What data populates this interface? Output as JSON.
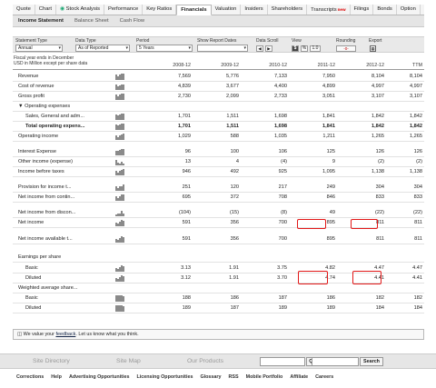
{
  "tabs": [
    "Quote",
    "Chart",
    "Stock Analysis",
    "Performance",
    "Key Ratios",
    "Financials",
    "Valuation",
    "Insiders",
    "Shareholders",
    "Transcripts",
    "Filings",
    "Bonds",
    "Option"
  ],
  "tabs_active": "Financials",
  "tabs_new_badge": "new",
  "subtabs": [
    "Income Statement",
    "Balance Sheet",
    "Cash Flow"
  ],
  "controls": {
    "statement_type": {
      "label": "Statement Type",
      "value": "Annual"
    },
    "data_type": {
      "label": "Data Type",
      "value": "As of Reported"
    },
    "period": {
      "label": "Period",
      "value": "5 Years"
    },
    "show_report_dates": {
      "label": "Show Report Dates",
      "value": ""
    },
    "data_scroll": {
      "label": "Data Scroll",
      "prev": "◀",
      "next": "▶"
    },
    "view": {
      "label": "View",
      "dollar": "$",
      "percent": "%",
      "zoom": "1.0"
    },
    "rounding": {
      "label": "Rounding",
      "value": "-0-"
    },
    "export": {
      "label": "Export"
    }
  },
  "fiscal_note_1": "Fiscal year ends in December",
  "fiscal_note_2": "USD in Million except per share data",
  "columns": [
    "2008-12",
    "2009-12",
    "2010-12",
    "2011-12",
    "2012-12",
    "TTM"
  ],
  "rows": [
    {
      "label": "Revenue",
      "values": [
        "7,569",
        "5,776",
        "7,133",
        "7,950",
        "8,104",
        "8,104"
      ],
      "spark": [
        7,
        5,
        7,
        8,
        8
      ]
    },
    {
      "label": "Cost of revenue",
      "values": [
        "4,839",
        "3,677",
        "4,400",
        "4,899",
        "4,997",
        "4,997"
      ],
      "spark": [
        7,
        5,
        6,
        7,
        7
      ]
    },
    {
      "label": "Gross profit",
      "values": [
        "2,730",
        "2,099",
        "2,733",
        "3,051",
        "3,107",
        "3,107"
      ],
      "spark": [
        7,
        5,
        7,
        8,
        8
      ]
    },
    {
      "label": "▼ Operating expenses",
      "values": [
        "",
        "",
        "",
        "",
        "",
        ""
      ],
      "spark": []
    },
    {
      "label": "Sales, General and adm...",
      "values": [
        "1,701",
        "1,511",
        "1,698",
        "1,841",
        "1,842",
        "1,842"
      ],
      "spark": [
        7,
        6,
        7,
        8,
        8
      ],
      "indent": true
    },
    {
      "label": "Total operating expens...",
      "values": [
        "1,701",
        "1,511",
        "1,698",
        "1,841",
        "1,842",
        "1,842"
      ],
      "spark": [
        7,
        6,
        7,
        8,
        8
      ],
      "indent": true,
      "bold": true
    },
    {
      "label": "Operating income",
      "values": [
        "1,029",
        "588",
        "1,035",
        "1,211",
        "1,265",
        "1,265"
      ],
      "spark": [
        6,
        4,
        6,
        7,
        8
      ]
    },
    {
      "label": "Interest Expense",
      "values": [
        "96",
        "100",
        "106",
        "125",
        "126",
        "126"
      ],
      "spark": [
        6,
        6,
        7,
        8,
        8
      ]
    },
    {
      "label": "Other income (expense)",
      "values": [
        "13",
        "4",
        "(4)",
        "9",
        "(2)",
        "(2)"
      ],
      "spark": [
        7,
        3,
        2,
        5,
        2
      ]
    },
    {
      "label": "Income before taxes",
      "values": [
        "946",
        "492",
        "925",
        "1,095",
        "1,138",
        "1,138"
      ],
      "spark": [
        6,
        3,
        6,
        7,
        8
      ]
    },
    {
      "label": "Provision for income t...",
      "values": [
        "251",
        "120",
        "217",
        "249",
        "304",
        "304"
      ],
      "spark": [
        6,
        3,
        6,
        6,
        8
      ]
    },
    {
      "label": "Net income from contin...",
      "values": [
        "695",
        "372",
        "708",
        "846",
        "833",
        "833"
      ],
      "spark": [
        6,
        3,
        6,
        8,
        8
      ]
    },
    {
      "label": "Net income from discon...",
      "values": [
        "(104)",
        "(15)",
        "(8)",
        "49",
        "(22)",
        "(22)"
      ],
      "spark": [
        2,
        4,
        4,
        7,
        3
      ]
    },
    {
      "label": "Net income",
      "values": [
        "591",
        "356",
        "700",
        "895",
        "811",
        "811"
      ],
      "spark": [
        5,
        3,
        6,
        8,
        7
      ]
    },
    {
      "label": "Net income available t...",
      "values": [
        "591",
        "356",
        "700",
        "895",
        "811",
        "811"
      ],
      "spark": [
        5,
        3,
        6,
        8,
        7
      ]
    },
    {
      "label": "Earnings per share",
      "values": [
        "",
        "",
        "",
        "",
        "",
        ""
      ],
      "spark": []
    },
    {
      "label": "Basic",
      "values": [
        "3.13",
        "1.91",
        "3.75",
        "4.82",
        "4.47",
        "4.47"
      ],
      "spark": [
        5,
        3,
        6,
        8,
        7
      ],
      "indent": true
    },
    {
      "label": "Diluted",
      "values": [
        "3.12",
        "1.91",
        "3.70",
        "4.74",
        "4.41",
        "4.41"
      ],
      "spark": [
        5,
        3,
        6,
        8,
        7
      ],
      "indent": true
    },
    {
      "label": "Weighted average share...",
      "values": [
        "",
        "",
        "",
        "",
        "",
        ""
      ],
      "spark": []
    },
    {
      "label": "Basic",
      "values": [
        "188",
        "186",
        "187",
        "186",
        "182",
        "182"
      ],
      "spark": [
        8,
        8,
        8,
        8,
        7
      ],
      "indent": true
    },
    {
      "label": "Diluted",
      "values": [
        "189",
        "187",
        "189",
        "189",
        "184",
        "184"
      ],
      "spark": [
        8,
        8,
        8,
        8,
        7
      ],
      "indent": true
    }
  ],
  "feedback": {
    "prefix": "We value your ",
    "link": "feedback",
    "suffix": ". Let us know what you think."
  },
  "bottom": {
    "site_directory": "Site Directory",
    "site_map": "Site Map",
    "our_products": "Our Products",
    "quote_btn": "Quote",
    "search_btn": "Search"
  },
  "footer_links": [
    "Corrections",
    "Help",
    "Advertising Opportunities",
    "Licensing Opportunities",
    "Glossary",
    "RSS",
    "Mobile Portfolio",
    "Affiliate",
    "Careers"
  ],
  "colors": {
    "highlight": "#e21818",
    "tab_bar": "#f4f4f4",
    "subtab_bar": "#e5e5e5"
  }
}
